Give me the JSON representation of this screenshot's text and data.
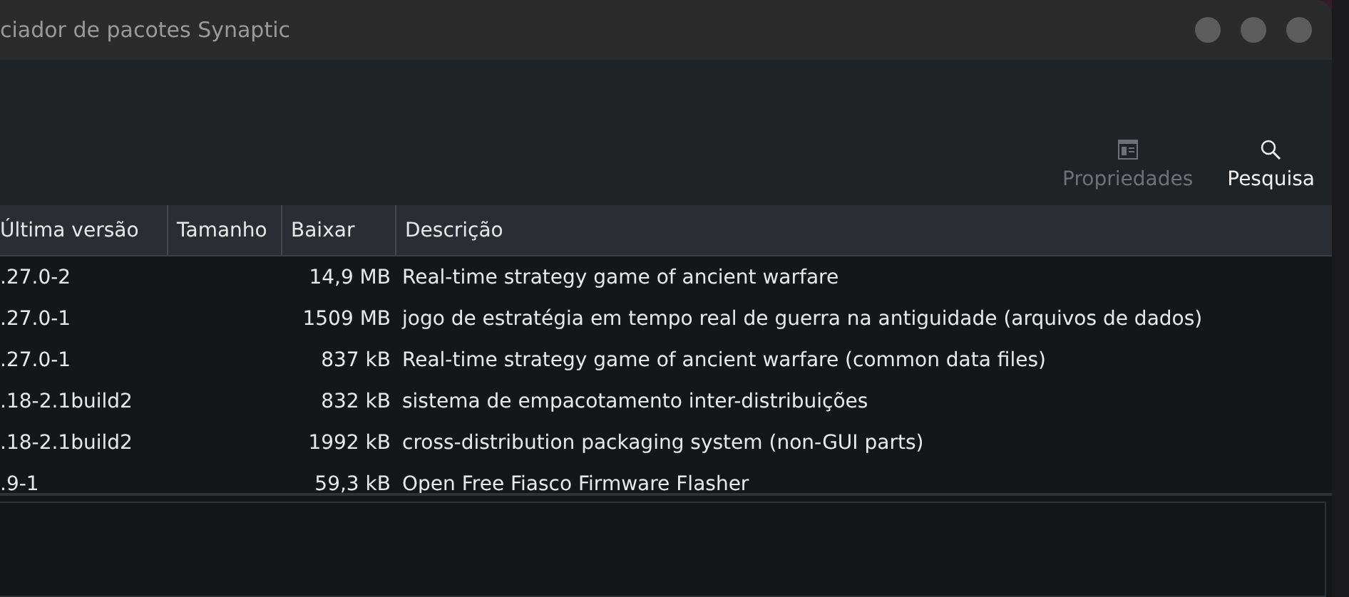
{
  "window": {
    "title": "ciador de pacotes Synaptic"
  },
  "toolbar": [
    {
      "label": "Propriedades",
      "kind": "properties",
      "disabled": true
    },
    {
      "label": "Pesquisa",
      "kind": "search",
      "disabled": false
    }
  ],
  "table": {
    "columns": [
      "Última versão",
      "Tamanho",
      "Baixar",
      "Descrição"
    ],
    "rows": [
      {
        "version": ".27.0-2",
        "download": "14,9 MB",
        "description": "Real-time strategy game of ancient warfare"
      },
      {
        "version": ".27.0-1",
        "download": "1509 MB",
        "description": "jogo de estratégia em tempo real de guerra na antiguidade (arquivos de dados)"
      },
      {
        "version": ".27.0-1",
        "download": "837 kB",
        "description": "Real-time strategy game of ancient warfare (common data files)"
      },
      {
        "version": ".18-2.1build2",
        "download": "832 kB",
        "description": "sistema de empacotamento inter-distribuições"
      },
      {
        "version": ".18-2.1build2",
        "download": "1992 kB",
        "description": "cross-distribution packaging system (non-GUI parts)"
      },
      {
        "version": ".9-1",
        "download": "59,3 kB",
        "description": "Open Free Fiasco Firmware Flasher"
      }
    ]
  }
}
